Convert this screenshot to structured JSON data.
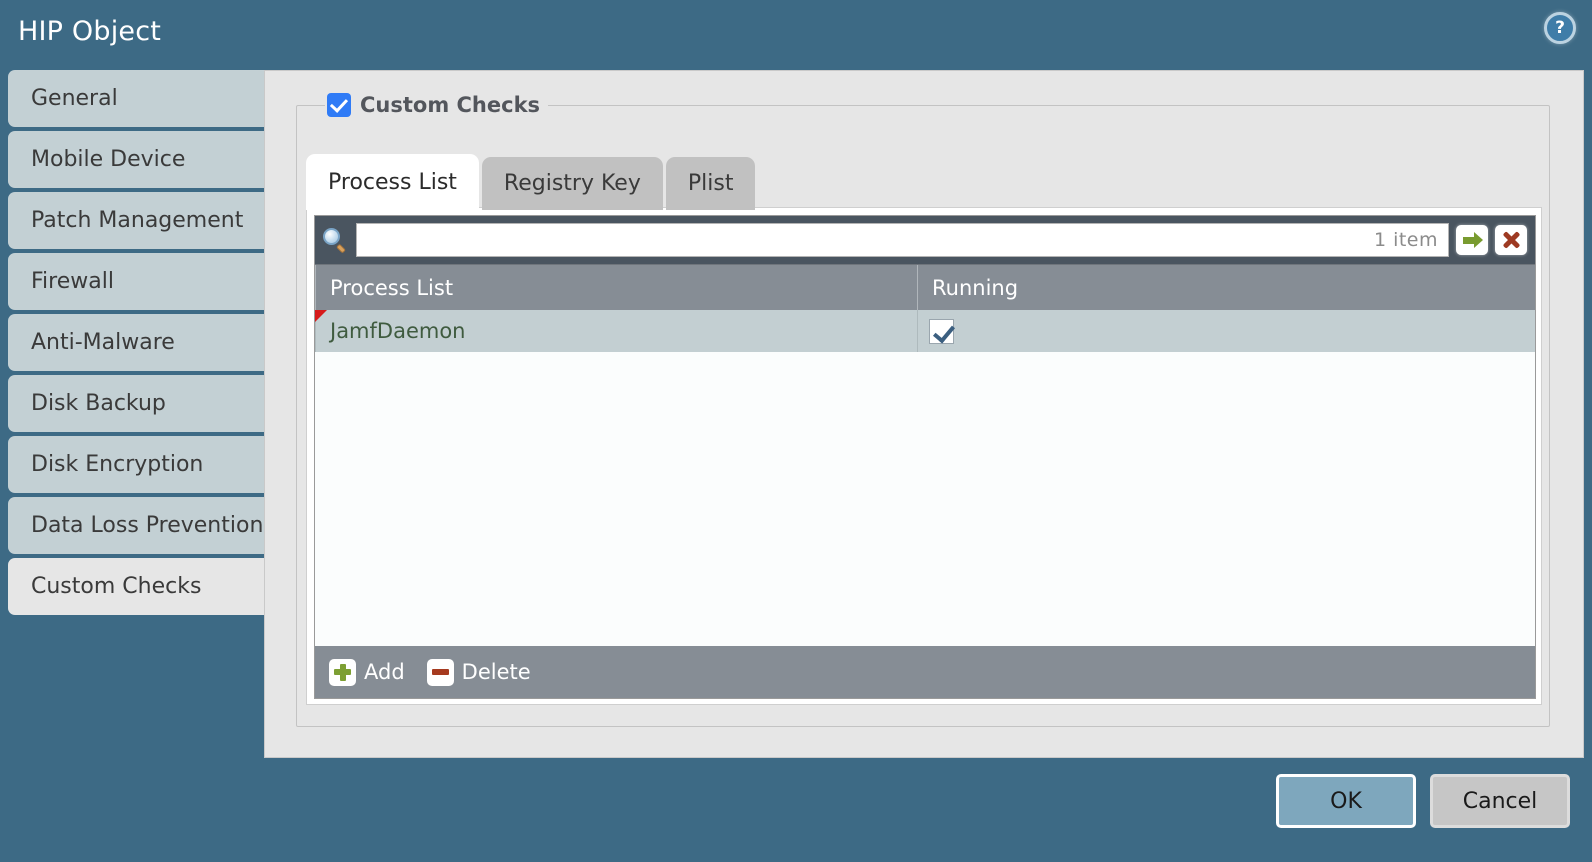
{
  "window": {
    "title": "HIP Object",
    "help_icon": "help-circle-icon",
    "help_glyph": "?"
  },
  "sidebar": {
    "items": [
      {
        "label": "General",
        "selected": false
      },
      {
        "label": "Mobile Device",
        "selected": false
      },
      {
        "label": "Patch Management",
        "selected": false
      },
      {
        "label": "Firewall",
        "selected": false
      },
      {
        "label": "Anti-Malware",
        "selected": false
      },
      {
        "label": "Disk Backup",
        "selected": false
      },
      {
        "label": "Disk Encryption",
        "selected": false
      },
      {
        "label": "Data Loss Prevention",
        "selected": false
      },
      {
        "label": "Custom Checks",
        "selected": true
      }
    ]
  },
  "panel": {
    "legend_label": "Custom Checks",
    "legend_checked": true,
    "tabs": [
      {
        "label": "Process List",
        "active": true
      },
      {
        "label": "Registry Key",
        "active": false
      },
      {
        "label": "Plist",
        "active": false
      }
    ]
  },
  "grid": {
    "search": {
      "icon": "search-icon",
      "value": "",
      "placeholder": "",
      "count_label": "1 item"
    },
    "apply_icon": "arrow-right-icon",
    "clear_icon": "close-x-icon",
    "columns": [
      "Process List",
      "Running"
    ],
    "rows": [
      {
        "name": "JamfDaemon",
        "running": true,
        "modified": true
      }
    ],
    "footer": {
      "add_label": "Add",
      "add_icon": "plus-icon",
      "delete_label": "Delete",
      "delete_icon": "minus-icon"
    }
  },
  "footer": {
    "ok_label": "OK",
    "cancel_label": "Cancel"
  },
  "colors": {
    "dialog_blue": "#3d6a85",
    "sidebar_item": "#c3d0d4",
    "content_gray": "#e6e6e6",
    "grid_header": "#868d95",
    "row_selected": "#c3cfd2",
    "accent_blue": "#2f7bf6",
    "add_green": "#7d9f33",
    "delete_red": "#a63a1f",
    "row_text_green": "#3f5b3f"
  }
}
